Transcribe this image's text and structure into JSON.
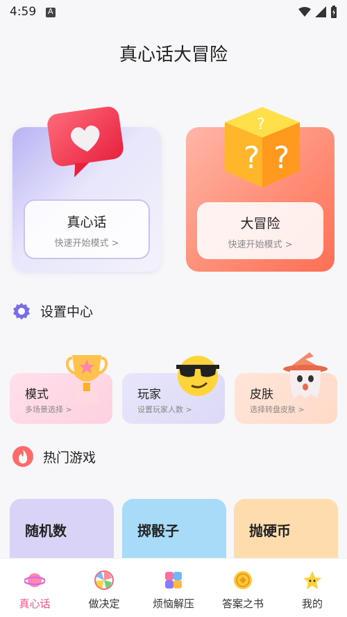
{
  "status": {
    "time": "4:59"
  },
  "app_title": "真心话大冒险",
  "cards": {
    "truth": {
      "title": "真心话",
      "subtitle": "快速开始模式 >"
    },
    "dare": {
      "title": "大冒险",
      "subtitle": "快速开始模式 >"
    }
  },
  "settings": {
    "title": "设置中心",
    "items": [
      {
        "title": "模式",
        "subtitle": "多场景选择 >"
      },
      {
        "title": "玩家",
        "subtitle": "设置玩家人数 >"
      },
      {
        "title": "皮肤",
        "subtitle": "选择转盘皮肤 >"
      }
    ]
  },
  "hot": {
    "title": "热门游戏",
    "games": [
      {
        "title": "随机数"
      },
      {
        "title": "掷骰子"
      },
      {
        "title": "抛硬币"
      }
    ]
  },
  "tabs": [
    {
      "label": "真心话",
      "active": true
    },
    {
      "label": "做决定",
      "active": false
    },
    {
      "label": "烦恼解压",
      "active": false
    },
    {
      "label": "答案之书",
      "active": false
    },
    {
      "label": "我的",
      "active": false
    }
  ],
  "colors": {
    "accent": "#ff4f8b",
    "fire": "#ff6b6b",
    "gear": "#7a6ee6"
  }
}
